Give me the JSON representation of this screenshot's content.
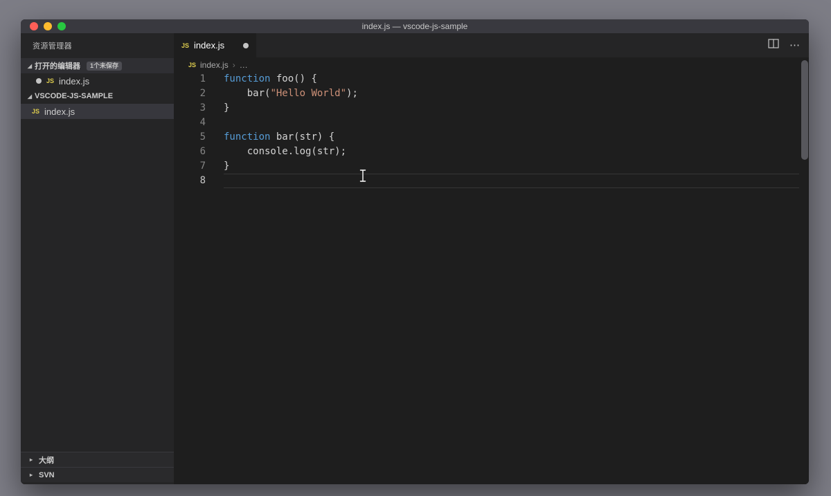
{
  "window": {
    "title": "index.js — vscode-js-sample"
  },
  "sidebar": {
    "title": "资源管理器",
    "open_editors": {
      "label": "打开的编辑器",
      "badge": "1个未保存",
      "items": [
        {
          "label": "index.js",
          "modified": true
        }
      ]
    },
    "folder": {
      "label": "VSCODE-JS-SAMPLE",
      "items": [
        {
          "label": "index.js",
          "selected": true
        }
      ]
    },
    "bottom": [
      {
        "label": "大纲"
      },
      {
        "label": "SVN"
      }
    ]
  },
  "editor": {
    "tab": {
      "label": "index.js",
      "modified": true,
      "active": true
    },
    "breadcrumb": {
      "file": "index.js",
      "more": "…"
    },
    "code": {
      "language": "javascript",
      "active_line": 8,
      "lines": [
        {
          "n": 1,
          "tokens": [
            {
              "t": "function",
              "c": "kw"
            },
            {
              "t": " foo() {",
              "c": "pln"
            }
          ]
        },
        {
          "n": 2,
          "tokens": [
            {
              "t": "    bar(",
              "c": "pln"
            },
            {
              "t": "\"Hello World\"",
              "c": "str"
            },
            {
              "t": ");",
              "c": "pln"
            }
          ]
        },
        {
          "n": 3,
          "tokens": [
            {
              "t": "}",
              "c": "pln"
            }
          ]
        },
        {
          "n": 4,
          "tokens": []
        },
        {
          "n": 5,
          "tokens": [
            {
              "t": "function",
              "c": "kw"
            },
            {
              "t": " bar(str) {",
              "c": "pln"
            }
          ]
        },
        {
          "n": 6,
          "tokens": [
            {
              "t": "    console.log(str);",
              "c": "pln"
            }
          ]
        },
        {
          "n": 7,
          "tokens": [
            {
              "t": "}",
              "c": "pln"
            }
          ]
        },
        {
          "n": 8,
          "tokens": []
        }
      ]
    }
  },
  "icons": {
    "js_label": "JS",
    "twistie_expanded": "◢",
    "twistie_collapsed": "▸",
    "breadcrumb_separator": "›",
    "more_actions": "⋯"
  },
  "colors": {
    "desktop": "#7d7d86",
    "titlebar": "#39393f",
    "sidebar_bg": "#252526",
    "editor_bg": "#1e1e1e",
    "selection_row": "#37373d",
    "keyword": "#569cd6",
    "string": "#ce9178",
    "plain_text": "#d4d4d4",
    "js_icon": "#ddcc4e",
    "traffic_close": "#ff5f57",
    "traffic_minimize": "#febc2e",
    "traffic_zoom": "#28c840"
  }
}
